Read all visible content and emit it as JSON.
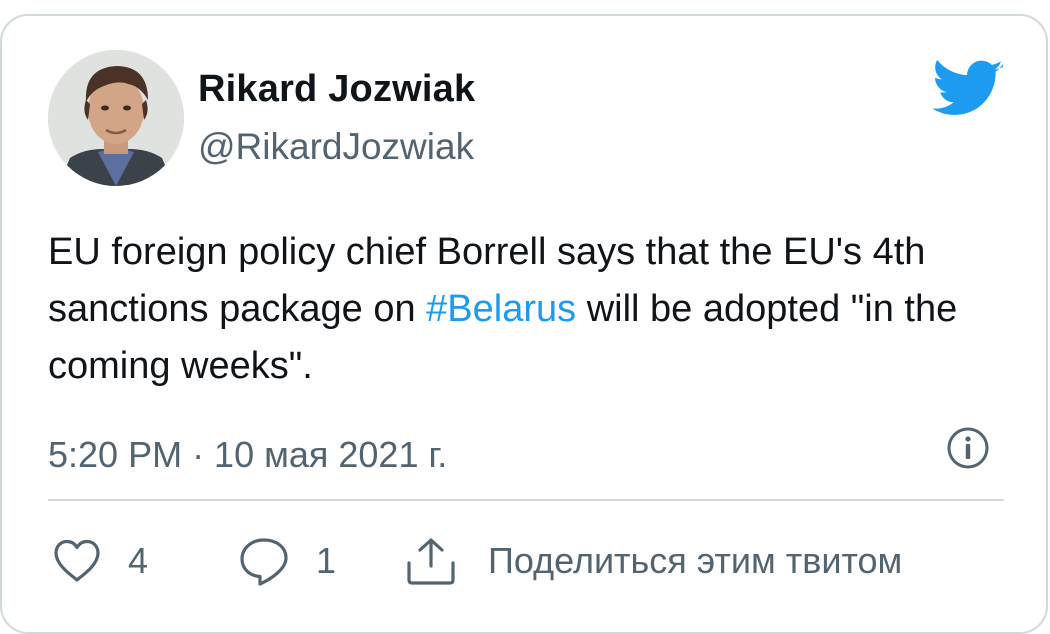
{
  "author": {
    "name": "Rikard Jozwiak",
    "handle": "@RikardJozwiak"
  },
  "tweet": {
    "text_before": "EU foreign policy chief Borrell says that the EU's 4th sanctions package on ",
    "hashtag": "#Belarus",
    "text_after": " will be adopted \"in the coming weeks\".",
    "timestamp": "5:20 PM · 10 мая 2021 г."
  },
  "actions": {
    "likes": "4",
    "replies": "1",
    "share_label": "Поделиться этим твитом"
  },
  "colors": {
    "brand": "#1d9bf0",
    "text": "#0f1419",
    "secondary": "#536471",
    "border": "#cfd9de"
  },
  "icons": {
    "brand": "twitter-bird-icon",
    "info": "info-icon",
    "like": "heart-icon",
    "reply": "comment-bubble-icon",
    "share": "share-upload-icon"
  }
}
